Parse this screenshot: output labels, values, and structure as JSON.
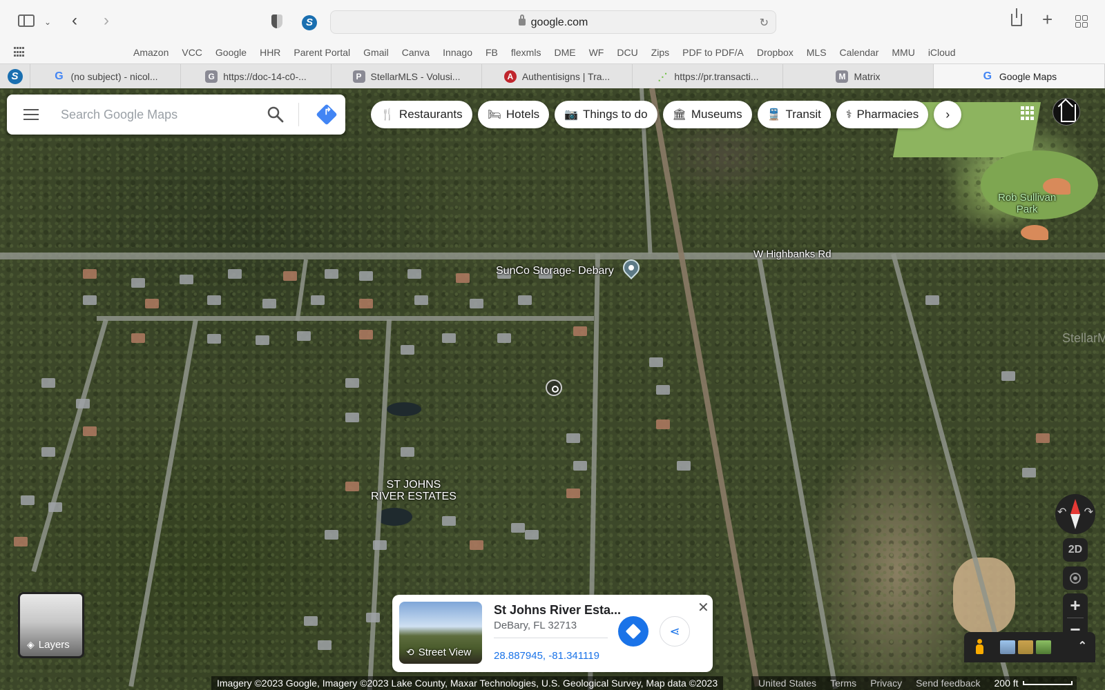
{
  "browser": {
    "address": "google.com",
    "bookmarks": [
      "Amazon",
      "VCC",
      "Google",
      "HHR",
      "Parent Portal",
      "Gmail",
      "Canva",
      "Innago",
      "FB",
      "flexmls",
      "DME",
      "WF",
      "DCU",
      "Zips",
      "PDF to PDF/A",
      "Dropbox",
      "MLS",
      "Calendar",
      "MMU",
      "iCloud"
    ],
    "tabs": [
      {
        "label": "(no subject) - nicol...",
        "favicon": "G",
        "kind": "g"
      },
      {
        "label": "https://doc-14-c0-...",
        "favicon": "G",
        "kind": "gray"
      },
      {
        "label": "StellarMLS - Volusi...",
        "favicon": "P",
        "kind": "gray"
      },
      {
        "label": "Authentisigns | Tra...",
        "favicon": "A",
        "kind": "red"
      },
      {
        "label": "https://pr.transacti...",
        "favicon": "⋰",
        "kind": "green"
      },
      {
        "label": "Matrix",
        "favicon": "M",
        "kind": "gray"
      },
      {
        "label": "Google Maps",
        "favicon": "G",
        "kind": "g",
        "active": true
      }
    ]
  },
  "maps": {
    "search_placeholder": "Search Google Maps",
    "chips": [
      {
        "label": "Restaurants",
        "icon": "🍴"
      },
      {
        "label": "Hotels",
        "icon": "🛏"
      },
      {
        "label": "Things to do",
        "icon": "📷"
      },
      {
        "label": "Museums",
        "icon": "🏛"
      },
      {
        "label": "Transit",
        "icon": "🚆"
      },
      {
        "label": "Pharmacies",
        "icon": "⚕"
      }
    ],
    "labels": {
      "road": "W Highbanks Rd",
      "poi": "SunCo Storage- Debary",
      "park_line1": "Rob Sullivan",
      "park_line2": "Park",
      "area_line1": "ST JOHNS",
      "area_line2": "RIVER ESTATES",
      "watermark": "StellarMLS"
    },
    "controls": {
      "mode_2d": "2D",
      "zoom_in": "+",
      "zoom_out": "−",
      "layers": "Layers"
    },
    "place_card": {
      "title": "St Johns River Esta...",
      "address": "DeBary, FL 32713",
      "coordinates": "28.887945, -81.341119",
      "street_view": "Street View"
    },
    "footer": {
      "attribution": "Imagery ©2023 Google, Imagery ©2023 Lake County, Maxar Technologies, U.S. Geological Survey, Map data ©2023",
      "region": "United States",
      "terms": "Terms",
      "privacy": "Privacy",
      "feedback": "Send feedback",
      "scale": "200 ft"
    },
    "colors": {
      "accent_blue": "#1a73e8",
      "compass_red": "#e53935",
      "pegman": "#f9ab00"
    }
  }
}
